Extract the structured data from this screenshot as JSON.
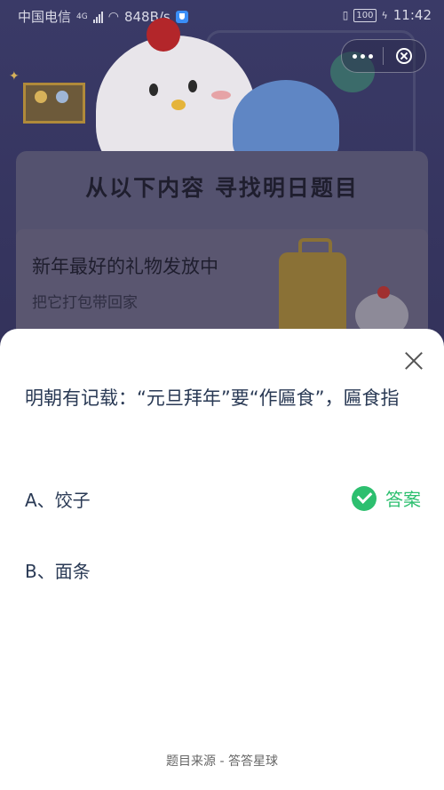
{
  "status_bar": {
    "carrier": "中国电信",
    "network": "4G",
    "speed": "848B/s",
    "battery": "100",
    "time": "11:42"
  },
  "capsule": {
    "more_icon": "more-dots-icon",
    "close_icon": "close-circle-icon"
  },
  "background": {
    "banner_title": "从以下内容 寻找明日题目",
    "item_title": "新年最好的礼物发放中",
    "item_subtitle": "把它打包带回家"
  },
  "sheet": {
    "question": "明朝有记载：“元旦拜年”要“作匾食”，匾食指",
    "options": [
      {
        "label": "A、饺子",
        "is_answer": true
      },
      {
        "label": "B、面条",
        "is_answer": false
      }
    ],
    "answer_label": "答案",
    "footer": "题目来源 - 答答星球"
  },
  "colors": {
    "accent_green": "#2dbf6f",
    "text_dark": "#2a3a55",
    "overlay_bg": "#34335c"
  }
}
